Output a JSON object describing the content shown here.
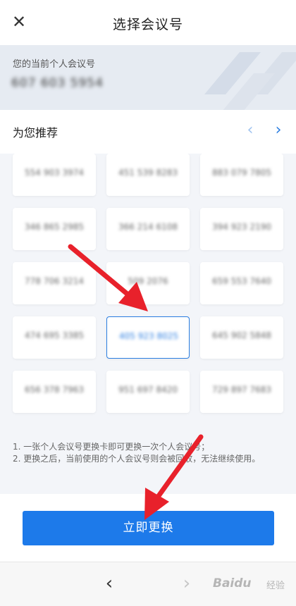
{
  "header": {
    "title": "选择会议号",
    "close_icon": "close-icon"
  },
  "current": {
    "label": "您的当前个人会议号",
    "number": "607 603 5954"
  },
  "recommend": {
    "title": "为您推荐",
    "prev_icon": "chevron-left-icon",
    "next_icon": "chevron-right-icon",
    "numbers": [
      "554 903 3974",
      "451 539 8283",
      "883 079 7805",
      "346 865 2985",
      "366 214 6108",
      "394 923 2190",
      "778 706 3214",
      "509 2076",
      "659 553 7640",
      "474 695 3385",
      "405 923 8025",
      "645 902 5848",
      "656 378 7963",
      "951 697 8420",
      "729 897 7683"
    ],
    "selected_index": 10
  },
  "notes": [
    "1. 一张个人会议号更换卡即可更换一次个人会议号；",
    "2. 更换之后，当前使用的个人会议号则会被回收，无法继续使用。"
  ],
  "action": {
    "confirm_label": "立即更换"
  },
  "browser": {
    "back_icon": "chevron-left-icon",
    "forward_icon": "chevron-right-icon",
    "watermark_text": "Baidu",
    "watermark_sub": "经验"
  },
  "colors": {
    "accent": "#1d7aea",
    "arrow": "#e8212b"
  }
}
